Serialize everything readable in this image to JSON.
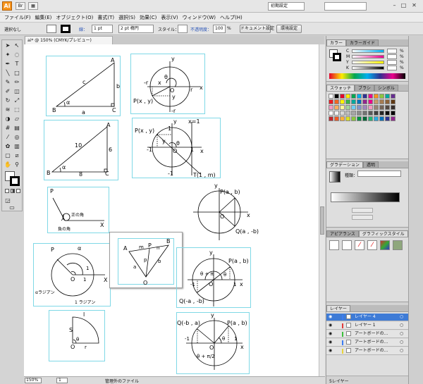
{
  "app": {
    "logo": "Ai",
    "workspace": "初期設定",
    "window_controls": [
      "–",
      "□",
      "✕"
    ]
  },
  "menu": [
    "ファイル(F)",
    "編集(E)",
    "オブジェクト(O)",
    "書式(T)",
    "選択(S)",
    "効果(C)",
    "表示(V)",
    "ウィンドウ(W)",
    "ヘルプ(H)"
  ],
  "control_bar": {
    "selection": "選択なし",
    "stroke_label": "線：",
    "stroke_weight": "1 pt",
    "brush": "2 pt 楕円",
    "style_label": "スタイル：",
    "opacity_label": "不透明度：",
    "opacity": "100",
    "opacity_unit": "%",
    "doc_setup": "ドキュメント設定",
    "prefs": "環境設定"
  },
  "document": {
    "tab": "ai* @ 150% (CMYK/プレビュー)",
    "zoom": "150%",
    "page": "1",
    "status": "管理外のファイル"
  },
  "panels": {
    "color_tabs": [
      "カラー",
      "カラーガイド"
    ],
    "color_channels": [
      "C",
      "M",
      "Y",
      "K"
    ],
    "percent": "%",
    "swatch_tabs": [
      "スウォッチ",
      "ブラシ",
      "シンボル"
    ],
    "gradient_tabs": [
      "グラデーション",
      "透明"
    ],
    "gradient_type": "種類：",
    "appearance_tabs": [
      "アピアランス",
      "グラフィックスタイル"
    ],
    "layers_tab": "レイヤー",
    "layers": [
      {
        "name": "レイヤー 4",
        "selected": true
      },
      {
        "name": "レイヤー 1",
        "selected": false
      },
      {
        "name": "アートボードの...",
        "selected": false
      },
      {
        "name": "アートボードの...",
        "selected": false
      },
      {
        "name": "アートボードの...",
        "selected": false
      }
    ],
    "layers_count": "5レイヤー"
  },
  "drawings": {
    "tri1": {
      "A": "A",
      "B": "B",
      "C": "C",
      "a": "a",
      "b": "b",
      "c": "c",
      "alpha": "α"
    },
    "circ1": {
      "y": "y",
      "x": "x",
      "r": "r",
      "neg_r": "-r",
      "neg_r2": "-r",
      "O": "O",
      "theta": "θ",
      "P": "P(x , y)",
      "sx": "x",
      "sy": "y"
    },
    "tri2": {
      "A": "A",
      "B": "B",
      "C": "C",
      "ten": "10",
      "six": "6",
      "eight": "8",
      "alpha": "α"
    },
    "circ2": {
      "y": "y",
      "x": "x",
      "P": "P(x , y)",
      "x1": "x=1",
      "one": "1",
      "neg1": "-1",
      "neg1b": "-1",
      "O": "O",
      "theta": "θ",
      "T": "T(1 , m)",
      "sy": "y",
      "one_b": "1"
    },
    "angle1": {
      "P": "P",
      "X": "X",
      "pos": "正の角",
      "neg": "負の角"
    },
    "circ3": {
      "y": "y",
      "x": "x",
      "P": "P(a , b)",
      "O": "O",
      "Q": "Q(a , -b)"
    },
    "vector": {
      "A": "A",
      "B": "B",
      "P": "P",
      "m": "m",
      "n": "n",
      "O": "O",
      "va": "a",
      "vp": "p",
      "vb": "b"
    },
    "radian": {
      "P": "P",
      "alpha": "α",
      "O": "O",
      "one": "1",
      "X": "X",
      "r1": "1",
      "label": "αラジアン",
      "label2": "1 ラジアン"
    },
    "circ4": {
      "y": "y",
      "x": "x",
      "P": "P(a , b)",
      "Q": "Q(-a , -b)",
      "O": "O",
      "tp": "θ + π",
      "theta": "θ",
      "neg1": "-1",
      "one": "1"
    },
    "sector": {
      "S": "S",
      "l": "l",
      "O": "O",
      "r": "r",
      "theta": "θ"
    },
    "circ5": {
      "y": "y",
      "x": "x",
      "Q": "Q(-b , a)",
      "P": "P(a , b)",
      "O": "O",
      "tp": "θ + π/2",
      "theta": "θ",
      "neg1": "-1",
      "one": "1"
    }
  }
}
